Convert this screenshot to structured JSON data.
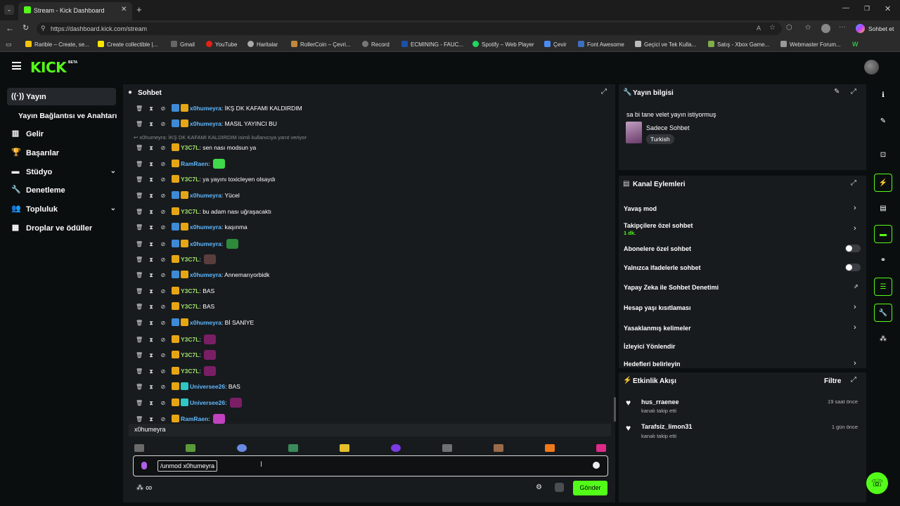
{
  "browser": {
    "tab_title": "Stream - Kick Dashboard",
    "url": "https://dashboard.kick.com/stream",
    "profile_label": "Sohbet et",
    "bookmarks": [
      "Rarible – Create, se...",
      "Create collectible |...",
      "Gmail",
      "YouTube",
      "Haritalar",
      "RollerCoin – Çevri...",
      "Record",
      "ECMINING - FAUC...",
      "Spotify – Web Player",
      "Çevir",
      "Font Awesome",
      "Geçici ve Tek Kulla...",
      "Satış - Xbox Game...",
      "Webmaster Forum..."
    ]
  },
  "app": {
    "logo": "KICK",
    "logo_beta": "BETA"
  },
  "sidebar": {
    "items": [
      {
        "label": "Yayın",
        "icon": "broadcast-icon"
      },
      {
        "label": "Yayın Bağlantısı ve Anahtarı",
        "icon": ""
      },
      {
        "label": "Gelir",
        "icon": "chart-icon"
      },
      {
        "label": "Başarılar",
        "icon": "trophy-icon"
      },
      {
        "label": "Stüdyo",
        "icon": "studio-icon"
      },
      {
        "label": "Denetleme",
        "icon": "wrench-icon"
      },
      {
        "label": "Topluluk",
        "icon": "community-icon"
      },
      {
        "label": "Droplar ve ödüller",
        "icon": "drops-icon"
      }
    ]
  },
  "chat": {
    "title": "Sohbet",
    "reply_notice": "x0humeyra: İKŞ DK KAFAMI KALDIRDIM isimli kullanıcıya yanıt veriyor",
    "messages": [
      {
        "user": "x0humeyra",
        "text": "İKŞ DK KAFAMI KALDIRDIM",
        "color": "#5fb8ff",
        "badges": [
          "blue",
          "gold"
        ]
      },
      {
        "user": "x0humeyra",
        "text": "MASIL YAYINCI BU",
        "color": "#5fb8ff",
        "badges": [
          "blue",
          "gold"
        ]
      },
      {
        "user": "Y3C7L",
        "text": "sen nası modsun ya",
        "color": "#9ee06a",
        "badges": [
          "gold"
        ]
      },
      {
        "user": "RamRaen",
        "text": "",
        "color": "#5fb8ff",
        "badges": [
          "gold"
        ],
        "emote": "#3fd94a"
      },
      {
        "user": "Y3C7L",
        "text": "ya yayını toxicleyen olsaydı",
        "color": "#9ee06a",
        "badges": [
          "gold"
        ]
      },
      {
        "user": "x0humeyra",
        "text": "Yücel",
        "color": "#5fb8ff",
        "badges": [
          "blue",
          "gold"
        ]
      },
      {
        "user": "Y3C7L",
        "text": "bu adam nası uğraşacaktı",
        "color": "#9ee06a",
        "badges": [
          "gold"
        ]
      },
      {
        "user": "x0humeyra",
        "text": "kaşınma",
        "color": "#5fb8ff",
        "badges": [
          "blue",
          "gold"
        ]
      },
      {
        "user": "x0humeyra",
        "text": "",
        "color": "#5fb8ff",
        "badges": [
          "blue",
          "gold"
        ],
        "emote": "#2d8a3a"
      },
      {
        "user": "Y3C7L",
        "text": "",
        "color": "#9ee06a",
        "badges": [
          "gold"
        ],
        "emote": "#5a3d3d"
      },
      {
        "user": "x0humeyra",
        "text": "Annemarıyorbidk",
        "color": "#5fb8ff",
        "badges": [
          "blue",
          "gold"
        ]
      },
      {
        "user": "Y3C7L",
        "text": "BAS",
        "color": "#9ee06a",
        "badges": [
          "gold"
        ]
      },
      {
        "user": "Y3C7L",
        "text": "BAS",
        "color": "#9ee06a",
        "badges": [
          "gold"
        ]
      },
      {
        "user": "x0humeyra",
        "text": "Bİ SANİYE",
        "color": "#5fb8ff",
        "badges": [
          "blue",
          "gold"
        ]
      },
      {
        "user": "Y3C7L",
        "text": "",
        "color": "#9ee06a",
        "badges": [
          "gold"
        ],
        "emote": "#7a1f66"
      },
      {
        "user": "Y3C7L",
        "text": "",
        "color": "#9ee06a",
        "badges": [
          "gold"
        ],
        "emote": "#7a1f66"
      },
      {
        "user": "Y3C7L",
        "text": "",
        "color": "#9ee06a",
        "badges": [
          "gold"
        ],
        "emote": "#7a1f66"
      },
      {
        "user": "Universee26",
        "text": "BAS",
        "color": "#5fb8ff",
        "badges": [
          "gold",
          "teal"
        ]
      },
      {
        "user": "Universee26",
        "text": "",
        "color": "#5fb8ff",
        "badges": [
          "gold",
          "teal"
        ],
        "emote": "#7a1f66"
      },
      {
        "user": "RamRaen",
        "text": "",
        "color": "#5fb8ff",
        "badges": [
          "gold"
        ],
        "emote": "#c042c0"
      }
    ],
    "mention_suggestion": "x0humeyra",
    "input_value": "/unmod x0humeyra",
    "send_label": "Gönder"
  },
  "stream_info": {
    "title": "Yayın bilgisi",
    "stream_title": "sa bi tane velet yayın istiyormuş",
    "category": "Sadece Sohbet",
    "language": "Turkish"
  },
  "channel_actions": {
    "title": "Kanal Eylemleri",
    "items": [
      {
        "label": "Yavaş mod",
        "control": "chevron"
      },
      {
        "label": "Takipçilere özel sohbet",
        "sub": "1 dk.",
        "control": "chevron"
      },
      {
        "label": "Abonelere özel sohbet",
        "control": "toggle"
      },
      {
        "label": "Yalnızca ifadelerle sohbet",
        "control": "toggle"
      },
      {
        "label": "Yapay Zeka ile Sohbet Denetimi",
        "control": "external"
      },
      {
        "label": "Hesap yaşı kısıtlaması",
        "control": "chevron"
      },
      {
        "label": "Yasaklanmış kelimeler",
        "control": "chevron"
      },
      {
        "label": "İzleyici Yönlendir",
        "control": "none"
      },
      {
        "label": "Hedefleri belirleyin",
        "control": "chevron"
      }
    ]
  },
  "activity": {
    "title": "Etkinlik Akışı",
    "filter_label": "Filtre",
    "events": [
      {
        "user": "hus_rraenee",
        "action": "kanalı takip etti",
        "time": "19 saat önce"
      },
      {
        "user": "Tarafsiz_limon31",
        "action": "kanalı takip etti",
        "time": "1 gün önce"
      }
    ]
  },
  "colors": {
    "accent": "#53fc18",
    "panel": "#181b1e",
    "bg": "#0b0e0f"
  }
}
